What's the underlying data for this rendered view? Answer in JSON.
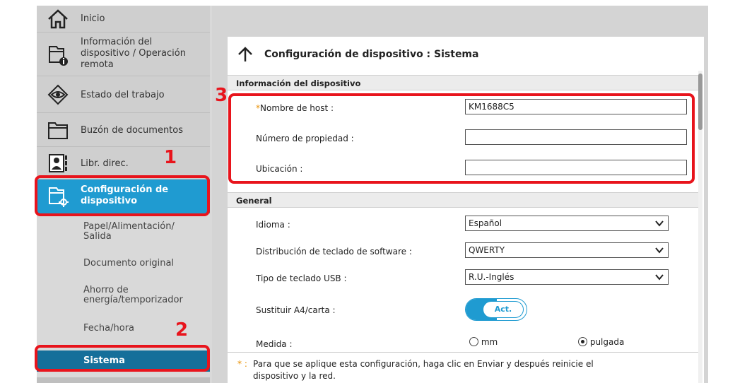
{
  "sidebar": {
    "items": [
      {
        "label": "Inicio",
        "icon": "home-icon"
      },
      {
        "label": "Información del dispositivo / Operación remota",
        "label_lines": [
          "Información del",
          "dispositivo / Operación",
          "remota"
        ],
        "icon": "device-info-icon"
      },
      {
        "label": "Estado del trabajo",
        "icon": "eye-icon"
      },
      {
        "label": "Buzón de documentos",
        "icon": "folder-icon"
      },
      {
        "label": "Libr. direc.",
        "icon": "address-book-icon"
      },
      {
        "label": "Configuración de dispositivo",
        "label_lines": [
          "Configuración de",
          "dispositivo"
        ],
        "icon": "device-settings-icon",
        "active": true
      }
    ],
    "subitems": [
      {
        "label_lines": [
          "Papel/Alimentación/",
          "Salida"
        ]
      },
      {
        "label_lines": [
          "Documento original"
        ]
      },
      {
        "label_lines": [
          "Ahorro de",
          "energía/temporizador"
        ]
      },
      {
        "label_lines": [
          "Fecha/hora"
        ]
      },
      {
        "label_lines": [
          "Sistema"
        ],
        "active": true
      }
    ]
  },
  "page": {
    "title": "Configuración de dispositivo : Sistema",
    "section_device_info": "Información del dispositivo",
    "host_label_asterisk": "*",
    "host_label": "Nombre de host :",
    "host_value": "KM1688C5",
    "asset_label": "Número de propiedad :",
    "asset_value": "",
    "location_label": "Ubicación :",
    "location_value": "",
    "section_general": "General",
    "language_label": "Idioma :",
    "language_value": "Español",
    "keyboard_layout_label": "Distribución de teclado de software :",
    "keyboard_layout_value": "QWERTY",
    "usb_keyboard_label": "Tipo de teclado USB :",
    "usb_keyboard_value": "R.U.-Inglés",
    "a4_letter_label": "Sustituir A4/carta :",
    "a4_letter_toggle": "Act.",
    "measure_label": "Medida :",
    "measure_mm": "mm",
    "measure_inch": "pulgada",
    "measure_selected": "pulgada",
    "footnote_marker": "* :",
    "footnote_line1": "Para que se aplique esta configuración, haga clic en Enviar y después reinicie el",
    "footnote_line2": "dispositivo y la red."
  },
  "callouts": [
    "1",
    "2",
    "3"
  ],
  "colors": {
    "accent": "#1f9bd1",
    "highlight": "#e8141c",
    "active_nav": "#1a8fc6",
    "active_sub": "#156f9a"
  }
}
